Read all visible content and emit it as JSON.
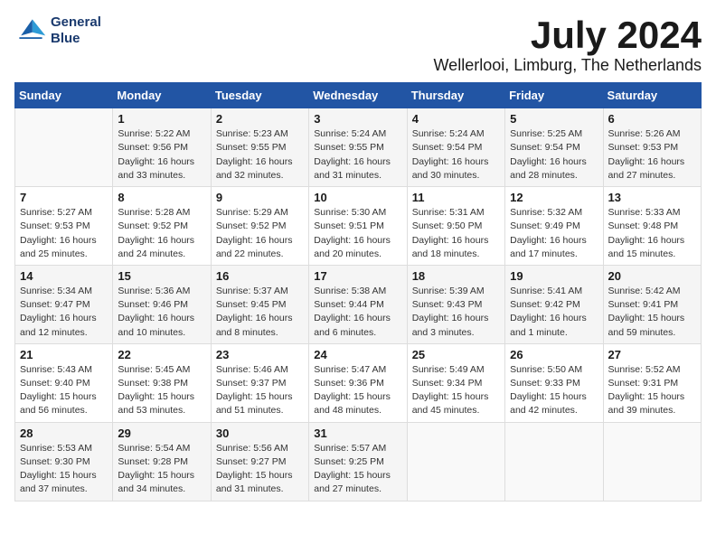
{
  "header": {
    "logo_line1": "General",
    "logo_line2": "Blue",
    "month_year": "July 2024",
    "location": "Wellerlooi, Limburg, The Netherlands"
  },
  "weekdays": [
    "Sunday",
    "Monday",
    "Tuesday",
    "Wednesday",
    "Thursday",
    "Friday",
    "Saturday"
  ],
  "weeks": [
    [
      {
        "day": "",
        "info": ""
      },
      {
        "day": "1",
        "info": "Sunrise: 5:22 AM\nSunset: 9:56 PM\nDaylight: 16 hours\nand 33 minutes."
      },
      {
        "day": "2",
        "info": "Sunrise: 5:23 AM\nSunset: 9:55 PM\nDaylight: 16 hours\nand 32 minutes."
      },
      {
        "day": "3",
        "info": "Sunrise: 5:24 AM\nSunset: 9:55 PM\nDaylight: 16 hours\nand 31 minutes."
      },
      {
        "day": "4",
        "info": "Sunrise: 5:24 AM\nSunset: 9:54 PM\nDaylight: 16 hours\nand 30 minutes."
      },
      {
        "day": "5",
        "info": "Sunrise: 5:25 AM\nSunset: 9:54 PM\nDaylight: 16 hours\nand 28 minutes."
      },
      {
        "day": "6",
        "info": "Sunrise: 5:26 AM\nSunset: 9:53 PM\nDaylight: 16 hours\nand 27 minutes."
      }
    ],
    [
      {
        "day": "7",
        "info": "Sunrise: 5:27 AM\nSunset: 9:53 PM\nDaylight: 16 hours\nand 25 minutes."
      },
      {
        "day": "8",
        "info": "Sunrise: 5:28 AM\nSunset: 9:52 PM\nDaylight: 16 hours\nand 24 minutes."
      },
      {
        "day": "9",
        "info": "Sunrise: 5:29 AM\nSunset: 9:52 PM\nDaylight: 16 hours\nand 22 minutes."
      },
      {
        "day": "10",
        "info": "Sunrise: 5:30 AM\nSunset: 9:51 PM\nDaylight: 16 hours\nand 20 minutes."
      },
      {
        "day": "11",
        "info": "Sunrise: 5:31 AM\nSunset: 9:50 PM\nDaylight: 16 hours\nand 18 minutes."
      },
      {
        "day": "12",
        "info": "Sunrise: 5:32 AM\nSunset: 9:49 PM\nDaylight: 16 hours\nand 17 minutes."
      },
      {
        "day": "13",
        "info": "Sunrise: 5:33 AM\nSunset: 9:48 PM\nDaylight: 16 hours\nand 15 minutes."
      }
    ],
    [
      {
        "day": "14",
        "info": "Sunrise: 5:34 AM\nSunset: 9:47 PM\nDaylight: 16 hours\nand 12 minutes."
      },
      {
        "day": "15",
        "info": "Sunrise: 5:36 AM\nSunset: 9:46 PM\nDaylight: 16 hours\nand 10 minutes."
      },
      {
        "day": "16",
        "info": "Sunrise: 5:37 AM\nSunset: 9:45 PM\nDaylight: 16 hours\nand 8 minutes."
      },
      {
        "day": "17",
        "info": "Sunrise: 5:38 AM\nSunset: 9:44 PM\nDaylight: 16 hours\nand 6 minutes."
      },
      {
        "day": "18",
        "info": "Sunrise: 5:39 AM\nSunset: 9:43 PM\nDaylight: 16 hours\nand 3 minutes."
      },
      {
        "day": "19",
        "info": "Sunrise: 5:41 AM\nSunset: 9:42 PM\nDaylight: 16 hours\nand 1 minute."
      },
      {
        "day": "20",
        "info": "Sunrise: 5:42 AM\nSunset: 9:41 PM\nDaylight: 15 hours\nand 59 minutes."
      }
    ],
    [
      {
        "day": "21",
        "info": "Sunrise: 5:43 AM\nSunset: 9:40 PM\nDaylight: 15 hours\nand 56 minutes."
      },
      {
        "day": "22",
        "info": "Sunrise: 5:45 AM\nSunset: 9:38 PM\nDaylight: 15 hours\nand 53 minutes."
      },
      {
        "day": "23",
        "info": "Sunrise: 5:46 AM\nSunset: 9:37 PM\nDaylight: 15 hours\nand 51 minutes."
      },
      {
        "day": "24",
        "info": "Sunrise: 5:47 AM\nSunset: 9:36 PM\nDaylight: 15 hours\nand 48 minutes."
      },
      {
        "day": "25",
        "info": "Sunrise: 5:49 AM\nSunset: 9:34 PM\nDaylight: 15 hours\nand 45 minutes."
      },
      {
        "day": "26",
        "info": "Sunrise: 5:50 AM\nSunset: 9:33 PM\nDaylight: 15 hours\nand 42 minutes."
      },
      {
        "day": "27",
        "info": "Sunrise: 5:52 AM\nSunset: 9:31 PM\nDaylight: 15 hours\nand 39 minutes."
      }
    ],
    [
      {
        "day": "28",
        "info": "Sunrise: 5:53 AM\nSunset: 9:30 PM\nDaylight: 15 hours\nand 37 minutes."
      },
      {
        "day": "29",
        "info": "Sunrise: 5:54 AM\nSunset: 9:28 PM\nDaylight: 15 hours\nand 34 minutes."
      },
      {
        "day": "30",
        "info": "Sunrise: 5:56 AM\nSunset: 9:27 PM\nDaylight: 15 hours\nand 31 minutes."
      },
      {
        "day": "31",
        "info": "Sunrise: 5:57 AM\nSunset: 9:25 PM\nDaylight: 15 hours\nand 27 minutes."
      },
      {
        "day": "",
        "info": ""
      },
      {
        "day": "",
        "info": ""
      },
      {
        "day": "",
        "info": ""
      }
    ]
  ]
}
